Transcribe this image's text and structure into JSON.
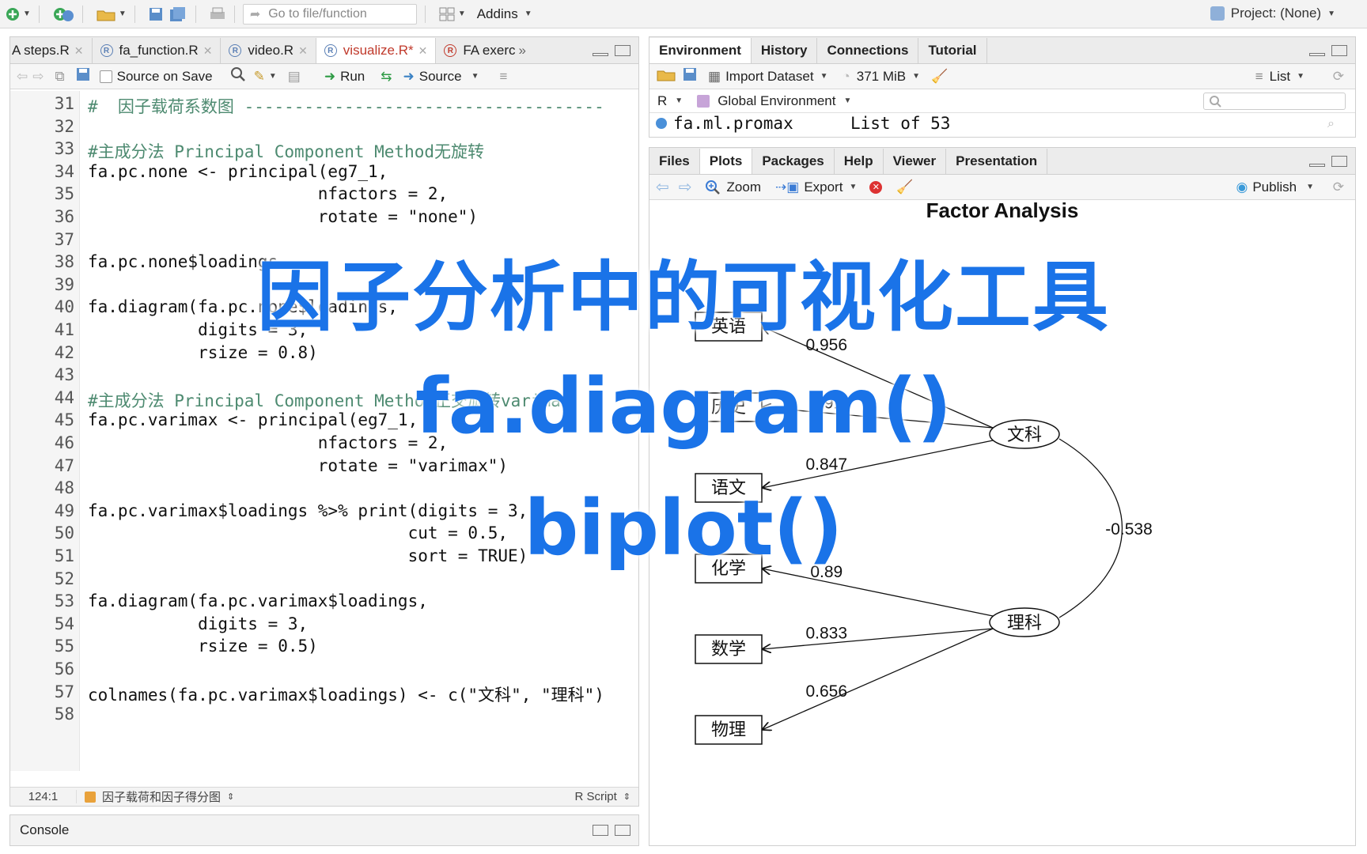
{
  "toolbar": {
    "goto_placeholder": "Go to file/function",
    "addins_label": "Addins",
    "project_label": "Project: (None)"
  },
  "editor": {
    "tabs": [
      {
        "label": "A steps.R"
      },
      {
        "label": "fa_function.R"
      },
      {
        "label": "video.R"
      },
      {
        "label": "visualize.R*"
      },
      {
        "label": "FA exerc"
      }
    ],
    "source_on_save": "Source on Save",
    "run_label": "Run",
    "source_label": "Source",
    "lines": [
      {
        "n": "31",
        "text": "#  因子载荷系数图 ------------------------------------"
      },
      {
        "n": "32",
        "text": ""
      },
      {
        "n": "33",
        "text": "#主成分法 Principal Component Method无旋转"
      },
      {
        "n": "34",
        "text": "fa.pc.none <- principal(eg7_1,"
      },
      {
        "n": "35",
        "text": "                       nfactors = 2,"
      },
      {
        "n": "36",
        "text": "                       rotate = \"none\")"
      },
      {
        "n": "37",
        "text": ""
      },
      {
        "n": "38",
        "text": "fa.pc.none$loadings"
      },
      {
        "n": "39",
        "text": ""
      },
      {
        "n": "40",
        "text": "fa.diagram(fa.pc.none$loadings,"
      },
      {
        "n": "41",
        "text": "           digits = 3,"
      },
      {
        "n": "42",
        "text": "           rsize = 0.8)"
      },
      {
        "n": "43",
        "text": ""
      },
      {
        "n": "44",
        "text": "#主成分法 Principal Component Method正交旋转varimax"
      },
      {
        "n": "45",
        "text": "fa.pc.varimax <- principal(eg7_1,"
      },
      {
        "n": "46",
        "text": "                       nfactors = 2,"
      },
      {
        "n": "47",
        "text": "                       rotate = \"varimax\")"
      },
      {
        "n": "48",
        "text": ""
      },
      {
        "n": "49",
        "text": "fa.pc.varimax$loadings %>% print(digits = 3,"
      },
      {
        "n": "50",
        "text": "                                cut = 0.5,"
      },
      {
        "n": "51",
        "text": "                                sort = TRUE)"
      },
      {
        "n": "52",
        "text": ""
      },
      {
        "n": "53",
        "text": "fa.diagram(fa.pc.varimax$loadings,"
      },
      {
        "n": "54",
        "text": "           digits = 3,"
      },
      {
        "n": "55",
        "text": "           rsize = 0.5)"
      },
      {
        "n": "56",
        "text": ""
      },
      {
        "n": "57",
        "text": "colnames(fa.pc.varimax$loadings) <- c(\"文科\", \"理科\")"
      },
      {
        "n": "58",
        "text": ""
      }
    ],
    "status_position": "124:1",
    "status_section": "因子载荷和因子得分图",
    "status_type": "R Script"
  },
  "console": {
    "label": "Console"
  },
  "environment": {
    "tabs": [
      "Environment",
      "History",
      "Connections",
      "Tutorial"
    ],
    "import_dataset": "Import Dataset",
    "memory": "371 MiB",
    "list_label": "List",
    "r_label": "R",
    "global_env": "Global Environment",
    "row_name": "fa.ml.promax",
    "row_value": "List of  53"
  },
  "plots": {
    "tabs": [
      "Files",
      "Plots",
      "Packages",
      "Help",
      "Viewer",
      "Presentation"
    ],
    "zoom_label": "Zoom",
    "export_label": "Export",
    "publish_label": "Publish",
    "diagram": {
      "title": "Factor Analysis",
      "variables": [
        "英语",
        "历史",
        "语文",
        "化学",
        "数学",
        "物理"
      ],
      "factors": [
        "文科",
        "理科"
      ],
      "loadings": [
        {
          "var": "英语",
          "factor": "文科",
          "label": "0.956"
        },
        {
          "var": "历史",
          "factor": "文科",
          "label": "0.91"
        },
        {
          "var": "语文",
          "factor": "文科",
          "label": "0.847"
        },
        {
          "var": "化学",
          "factor": "理科",
          "label": "0.89"
        },
        {
          "var": "数学",
          "factor": "理科",
          "label": "0.833"
        },
        {
          "var": "物理",
          "factor": "理科",
          "label": "0.656"
        }
      ],
      "factor_correlation": "-0.538"
    }
  },
  "overlay": {
    "line1": "因子分析中的可视化工具",
    "line2": "fa.diagram()",
    "line3": "biplot()"
  },
  "colors": {
    "overlay": "#1a73e8",
    "active_tab": "#c0392b"
  }
}
